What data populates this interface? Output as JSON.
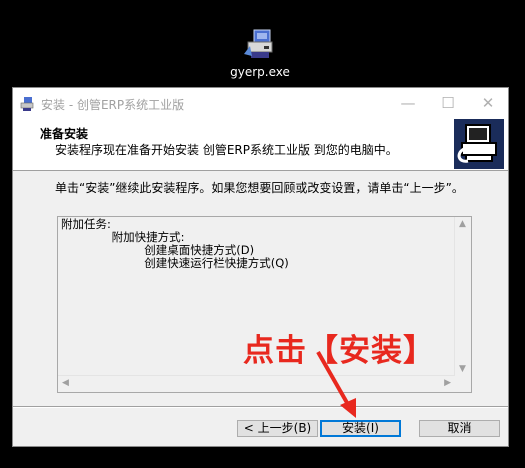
{
  "desktop": {
    "icon_name": "installer-exe-icon",
    "label": "gyerp.exe"
  },
  "window": {
    "title": "安装 - 创管ERP系统工业版",
    "controls": {
      "minimize": "—",
      "maximize": "☐",
      "close": "✕"
    },
    "header": {
      "title": "准备安装",
      "subtitle": "安装程序现在准备开始安装 创管ERP系统工业版 到您的电脑中。"
    },
    "message": "单击“安装”继续此安装程序。如果您想要回顾或改变设置，请单击“上一步”。",
    "info_lines": [
      "附加任务:",
      "    附加快捷方式:",
      "        创建桌面快捷方式(D)",
      "        创建快速运行栏快捷方式(Q)"
    ],
    "buttons": {
      "back": "< 上一步(B)",
      "install": "安装(I)",
      "cancel": "取消"
    }
  },
  "annotation": {
    "text": "点击【安装】",
    "color": "#e8281e"
  },
  "colors": {
    "desktop_bg": "#000000",
    "window_bg": "#f0f0f0",
    "focus_border": "#0078d7"
  }
}
